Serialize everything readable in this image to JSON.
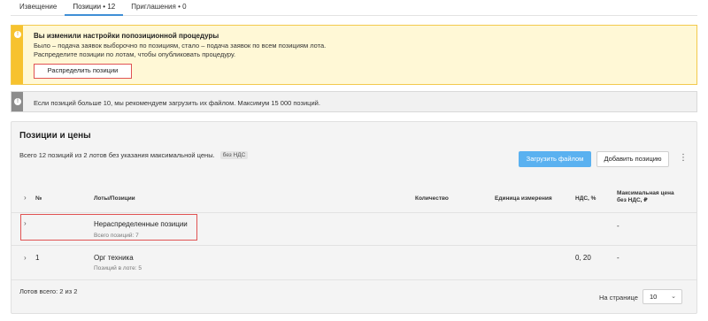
{
  "tabs": [
    {
      "label": "Извещение"
    },
    {
      "label": "Позиции • 12"
    },
    {
      "label": "Приглашения • 0"
    }
  ],
  "warning": {
    "icon": "exclamation-icon",
    "title": "Вы изменили настройки попозиционной процедуры",
    "line1": "Было – подача заявок выборочно по позициям, стало – подача заявок по всем позициям лота.",
    "line2": "Распределите позиции по лотам, чтобы опубликовать процедуру.",
    "button": "Распределить позиции",
    "accent": "#f7c22e"
  },
  "info": {
    "icon": "exclamation-icon",
    "text": "Если позиций больше 10, мы рекомендуем загрузить их файлом. Максимум 15 000 позиций."
  },
  "panel": {
    "title": "Позиции и цены",
    "summary": "Всего 12 позиций из 2 лотов без указания максимальной цены.",
    "tag": "без НДС",
    "upload_button": "Загрузить файлом",
    "add_button": "Добавить позицию",
    "upload_color": "#5ab1f0"
  },
  "table": {
    "headers": {
      "num": "№",
      "lots": "Лоты/Позиции",
      "qty": "Количество",
      "unit": "Единица измерения",
      "vat": "НДС, %",
      "maxprice_1": "Максимальная цена",
      "maxprice_2": "без НДС, ₽"
    },
    "rows": [
      {
        "num": "",
        "name": "Нераспределенные позиции",
        "sub": "Всего позиций: 7",
        "vat": "",
        "price": "-"
      },
      {
        "num": "1",
        "name": "Орг техника",
        "sub": "Позиций в лоте: 5",
        "vat": "0, 20",
        "price": "-"
      }
    ]
  },
  "footer": {
    "lots_total": "Лотов всего: 2 из 2",
    "per_page_label": "На странице",
    "per_page_value": "10"
  }
}
